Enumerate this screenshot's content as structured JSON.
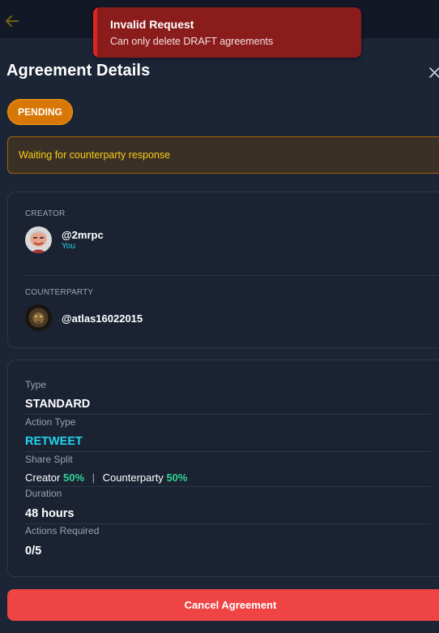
{
  "header": {
    "title": "Agreement Details"
  },
  "status": {
    "badge": "PENDING",
    "notice": "Waiting for counterparty response",
    "badge_color": "#d97706"
  },
  "parties": {
    "creator_label": "CREATOR",
    "creator_handle": "@2mrpc",
    "creator_tag": "You",
    "counterparty_label": "COUNTERPARTY",
    "counterparty_handle": "@atlas16022015"
  },
  "details": {
    "type_label": "Type",
    "type_value": "STANDARD",
    "action_type_label": "Action Type",
    "action_type_value": "RETWEET",
    "share_split_label": "Share Split",
    "creator_word": "Creator",
    "creator_pct": "50%",
    "separator": "|",
    "counterparty_word": "Counterparty",
    "counterparty_pct": "50%",
    "duration_label": "Duration",
    "duration_value": "48 hours",
    "actions_label": "Actions Required",
    "actions_value": "0/5"
  },
  "actions": {
    "cancel_label": "Cancel Agreement"
  },
  "toast": {
    "title": "Invalid Request",
    "message": "Can only delete DRAFT agreements"
  },
  "icons": {
    "back": "arrow-left-icon",
    "close": "close-icon"
  },
  "colors": {
    "accent_cyan": "#22d3ee",
    "percent_green": "#34d399",
    "danger": "#ef4444",
    "warning_text": "#facc15"
  }
}
